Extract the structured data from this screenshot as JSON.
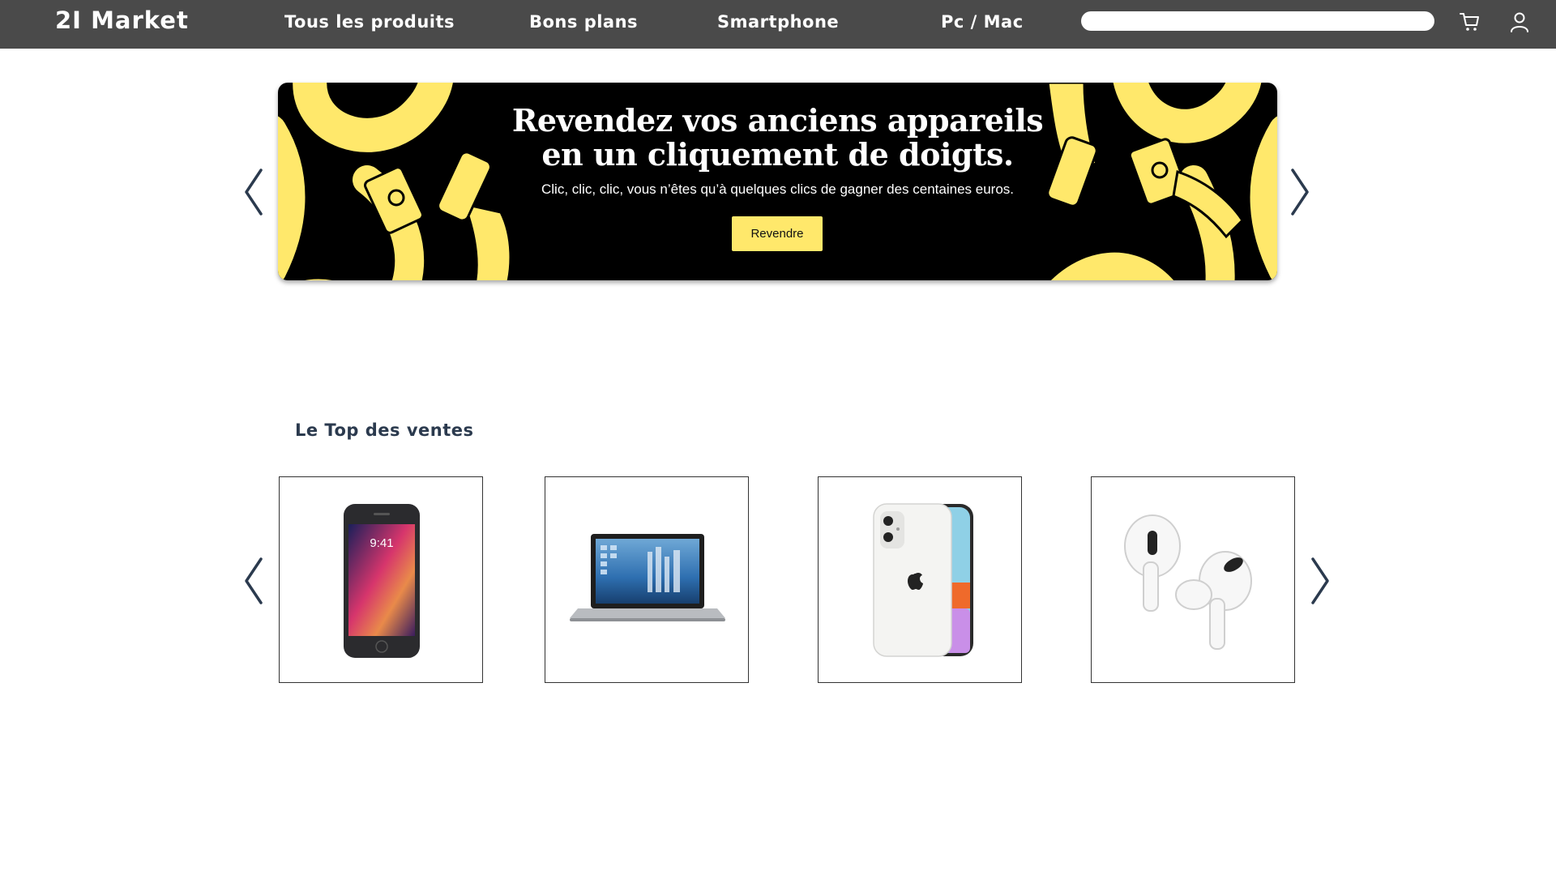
{
  "header": {
    "brand": "2I Market",
    "nav": [
      {
        "label": "Tous les produits"
      },
      {
        "label": "Bons plans"
      },
      {
        "label": "Smartphone"
      },
      {
        "label": "Pc / Mac"
      }
    ],
    "search": {
      "placeholder": "",
      "value": ""
    },
    "icons": [
      "cart-icon",
      "user-icon"
    ]
  },
  "banner": {
    "title_line1": "Revendez vos anciens appareils",
    "title_line2": "en un cliquement de doigts.",
    "subtitle": "Clic, clic, clic, vous n’êtes qu’à quelques clics de gagner des centaines euros.",
    "button_label": "Revendre",
    "colors": {
      "background": "#000000",
      "accent": "#ffe86b"
    }
  },
  "top_sales": {
    "title": "Le Top des ventes",
    "products": [
      {
        "image": "iphone-8-image",
        "screen_time": "9:41"
      },
      {
        "image": "laptop-image"
      },
      {
        "image": "iphone-11-white-image"
      },
      {
        "image": "airpods-pro-image"
      }
    ]
  },
  "carousel_icons": [
    "chevron-left-icon",
    "chevron-right-icon"
  ],
  "colors": {
    "navbar": "#4a4a4a",
    "heading": "#2b3a4e",
    "arrow": "#2b3a4e"
  }
}
